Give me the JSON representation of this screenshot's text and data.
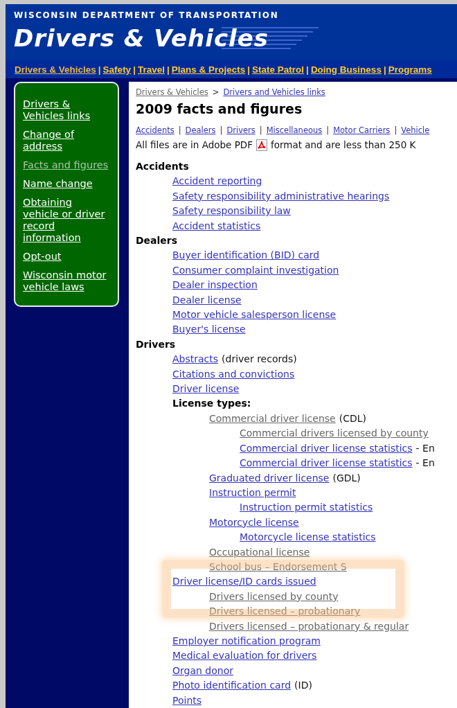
{
  "header": {
    "agency": "WISCONSIN DEPARTMENT OF TRANSPORTATION",
    "logo": "Drivers & Vehicles"
  },
  "nav": {
    "separator": "|",
    "links": [
      {
        "text": "Drivers & Vehicles",
        "visited": true
      },
      {
        "text": "Safety",
        "visited": false
      },
      {
        "text": "Travel",
        "visited": false
      },
      {
        "text": "Plans & Projects",
        "visited": false
      },
      {
        "text": "State Patrol",
        "visited": false
      },
      {
        "text": "Doing Business",
        "visited": false
      },
      {
        "text": "Programs",
        "visited": false
      }
    ]
  },
  "sidebar": {
    "items": [
      {
        "text": "Drivers & Vehicles links",
        "visited": false
      },
      {
        "text": "Change of address",
        "visited": false
      },
      {
        "text": "Facts and figures",
        "visited": true
      },
      {
        "text": "Name change",
        "visited": false
      },
      {
        "text": "Obtaining vehicle or driver record information",
        "visited": false
      },
      {
        "text": "Opt-out",
        "visited": false
      },
      {
        "text": "Wisconsin motor vehicle laws",
        "visited": false
      }
    ]
  },
  "breadcrumb": {
    "separator": ">",
    "links": [
      {
        "text": "Drivers & Vehicles",
        "visited": true
      },
      {
        "text": "Drivers and Vehicles links",
        "visited": false
      }
    ]
  },
  "title": "2009 facts and figures",
  "jump_links": {
    "separator": "|",
    "links": [
      {
        "text": "Accidents",
        "visited": false
      },
      {
        "text": "Dealers",
        "visited": false
      },
      {
        "text": "Drivers",
        "visited": false
      },
      {
        "text": "Miscellaneous",
        "visited": false
      },
      {
        "text": "Motor Carriers",
        "visited": false
      },
      {
        "text": "Vehicle",
        "visited": false
      }
    ]
  },
  "intro": {
    "before": "All files are in Adobe PDF",
    "after": "format and are less than 250 K"
  },
  "sections": [
    {
      "heading": "Accidents",
      "items": [
        {
          "kind": "link",
          "text": "Accident reporting",
          "visited": false
        },
        {
          "kind": "link",
          "text": "Safety responsibility administrative hearings",
          "visited": false
        },
        {
          "kind": "link",
          "text": "Safety responsibility law",
          "visited": false
        },
        {
          "kind": "link",
          "text": "Accident statistics",
          "visited": false
        }
      ]
    },
    {
      "heading": "Dealers",
      "items": [
        {
          "kind": "link",
          "text": "Buyer identification (BID) card",
          "visited": false
        },
        {
          "kind": "link",
          "text": "Consumer complaint investigation",
          "visited": false
        },
        {
          "kind": "link",
          "text": "Dealer inspection",
          "visited": false
        },
        {
          "kind": "link",
          "text": "Dealer license",
          "visited": false
        },
        {
          "kind": "link",
          "text": "Motor vehicle salesperson license",
          "visited": false
        },
        {
          "kind": "link",
          "text": "Buyer's license",
          "visited": false
        }
      ]
    },
    {
      "heading": "Drivers",
      "items": [
        {
          "kind": "link",
          "text": "Abstracts",
          "note": "(driver records)",
          "visited": false
        },
        {
          "kind": "link",
          "text": "Citations and convictions",
          "visited": false
        },
        {
          "kind": "link",
          "text": "Driver license",
          "visited": false
        },
        {
          "kind": "label",
          "text": "License types:",
          "children": [
            {
              "kind": "link",
              "text": "Commercial driver license",
              "note": "(CDL)",
              "visited": true,
              "children": [
                {
                  "kind": "link",
                  "text": "Commercial drivers licensed by county",
                  "visited": true
                },
                {
                  "kind": "link",
                  "text": "Commercial driver license statistics",
                  "note": "- En",
                  "visited": false
                },
                {
                  "kind": "link",
                  "text": "Commercial driver license statistics",
                  "note": "- En",
                  "visited": false
                }
              ]
            },
            {
              "kind": "link",
              "text": "Graduated driver license",
              "note": "(GDL)",
              "visited": false
            },
            {
              "kind": "link",
              "text": "Instruction permit",
              "visited": false,
              "children": [
                {
                  "kind": "link",
                  "text": "Instruction permit statistics",
                  "visited": false
                }
              ]
            },
            {
              "kind": "link",
              "text": "Motorcycle license",
              "visited": false,
              "children": [
                {
                  "kind": "link",
                  "text": "Motorcycle license statistics",
                  "visited": false
                }
              ]
            },
            {
              "kind": "link",
              "text": "Occupational license",
              "visited": true
            },
            {
              "kind": "link",
              "text": "School bus – Endorsement S",
              "visited": true
            }
          ]
        },
        {
          "kind": "link",
          "text": "Driver license/ID cards issued",
          "visited": false,
          "children": [
            {
              "kind": "link",
              "text": "Drivers licensed by county",
              "visited": true
            },
            {
              "kind": "link",
              "text": "Drivers licensed – probationary",
              "visited": true
            },
            {
              "kind": "link",
              "text": "Drivers licensed – probationary & regular",
              "visited": true
            }
          ]
        },
        {
          "kind": "link",
          "text": "Employer notification program",
          "visited": false
        },
        {
          "kind": "link",
          "text": "Medical evaluation for drivers",
          "visited": false
        },
        {
          "kind": "link",
          "text": "Organ donor",
          "visited": false
        },
        {
          "kind": "link",
          "text": "Photo identification card",
          "note": "(ID)",
          "visited": false
        },
        {
          "kind": "link",
          "text": "Points",
          "visited": false
        }
      ]
    }
  ]
}
